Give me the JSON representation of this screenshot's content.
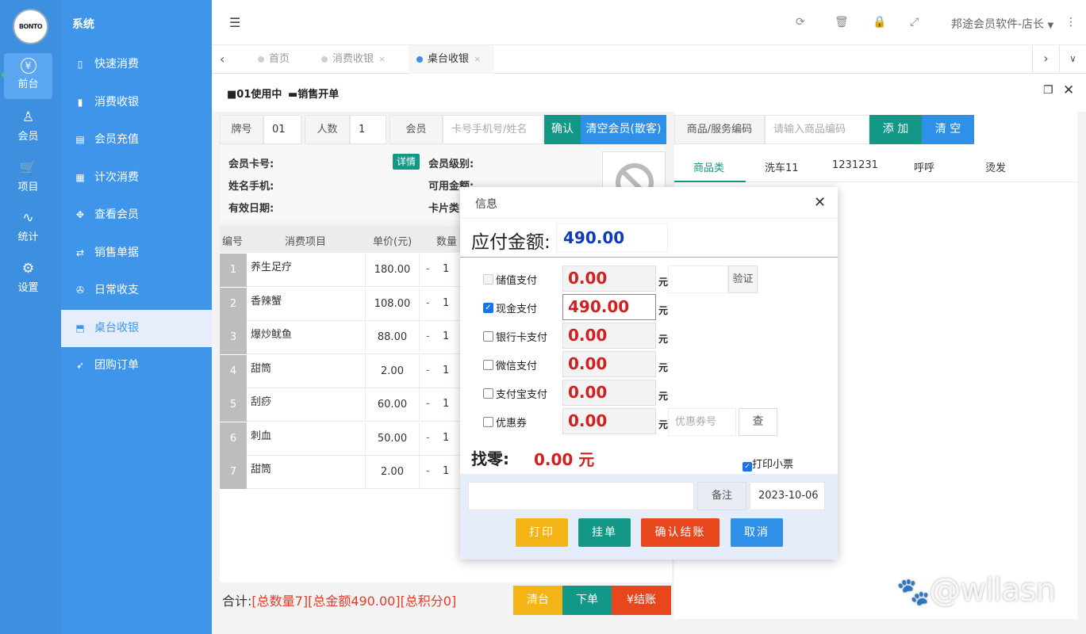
{
  "brand": {
    "logo_text": "BONTO"
  },
  "rail": {
    "items": [
      {
        "label": "前台",
        "icon": "yen-icon",
        "glyph": "¥"
      },
      {
        "label": "会员",
        "icon": "user-icon",
        "glyph": "♙"
      },
      {
        "label": "项目",
        "icon": "cart-icon",
        "glyph": "🛒"
      },
      {
        "label": "统计",
        "icon": "pulse-icon",
        "glyph": "∿"
      },
      {
        "label": "设置",
        "icon": "gear-icon",
        "glyph": "⚙"
      }
    ]
  },
  "menu": {
    "title": "系统",
    "items": [
      {
        "label": "快速消费",
        "icon": "bookmark-icon",
        "glyph": "▯"
      },
      {
        "label": "消费收银",
        "icon": "bookmark-fill-icon",
        "glyph": "▮"
      },
      {
        "label": "会员充值",
        "icon": "card-icon",
        "glyph": "▤"
      },
      {
        "label": "计次消费",
        "icon": "calculator-icon",
        "glyph": "▦"
      },
      {
        "label": "查看会员",
        "icon": "crosshair-icon",
        "glyph": "✥"
      },
      {
        "label": "销售单据",
        "icon": "swap-icon",
        "glyph": "⇄"
      },
      {
        "label": "日常收支",
        "icon": "dots-icon",
        "glyph": "✇"
      },
      {
        "label": "桌台收银",
        "icon": "inbox-icon",
        "glyph": "⬒"
      },
      {
        "label": "团购订单",
        "icon": "send-icon",
        "glyph": "➶"
      }
    ]
  },
  "topbar": {
    "user": "邦途会员软件-店长",
    "icons": [
      "menu-icon",
      "refresh-icon",
      "trash-icon",
      "lock-icon",
      "fullscreen-icon",
      "more-icon"
    ]
  },
  "tabs": [
    {
      "label": "首页"
    },
    {
      "label": "消费收银",
      "close": "×"
    },
    {
      "label": "桌台收银",
      "close": "×"
    }
  ],
  "work_header": {
    "table_status": "01使用中",
    "sale_open": "销售开单"
  },
  "order_form": {
    "table_label": "牌号",
    "table_value": "01",
    "people_label": "人数",
    "people_value": "1",
    "member_label": "会员",
    "member_placeholder": "卡号手机号/姓名",
    "confirm": "确认",
    "clear_member": "清空会员(散客)"
  },
  "product_form": {
    "code_label": "商品/服务编码",
    "code_placeholder": "请输入商品编码",
    "add": "添 加",
    "clear": "清 空"
  },
  "member_info": {
    "card_no": "会员卡号:",
    "detail": "详情",
    "level": "会员级别:",
    "phone": "姓名手机:",
    "balance": "可用金额:",
    "expiry": "有效日期:",
    "card_type": "卡片类"
  },
  "items_table": {
    "headers": [
      "编号",
      "消费项目",
      "单价(元)",
      "数量"
    ],
    "rows": [
      {
        "no": "1",
        "name": "养生足疗",
        "price": "180.00",
        "minus": "-",
        "qty": "1"
      },
      {
        "no": "2",
        "name": "香辣蟹",
        "price": "108.00",
        "minus": "-",
        "qty": "1"
      },
      {
        "no": "3",
        "name": "爆炒鱿鱼",
        "price": "88.00",
        "minus": "-",
        "qty": "1"
      },
      {
        "no": "4",
        "name": "甜筒",
        "price": "2.00",
        "minus": "-",
        "qty": "1"
      },
      {
        "no": "5",
        "name": "刮痧",
        "price": "60.00",
        "minus": "-",
        "qty": "1"
      },
      {
        "no": "6",
        "name": "刺血",
        "price": "50.00",
        "minus": "-",
        "qty": "1"
      },
      {
        "no": "7",
        "name": "甜筒",
        "price": "2.00",
        "minus": "-",
        "qty": "1"
      }
    ]
  },
  "footer": {
    "total_label": "合计:",
    "total_qty": "[总数量7]",
    "total_amount": "[总金额490.00]",
    "total_points": "[总积分0]",
    "clear_table": "清台",
    "place_order": "下单",
    "checkout": "¥结账"
  },
  "categories": [
    "商品类",
    "洗车11",
    "1231231",
    "呼呼",
    "烫发"
  ],
  "dialog": {
    "title": "信息",
    "payable_label": "应付金额:",
    "payable_value": "490.00",
    "payments": [
      {
        "label": "储值支付",
        "value": "0.00",
        "checked": false,
        "disabled": true
      },
      {
        "label": "现金支付",
        "value": "490.00",
        "checked": true
      },
      {
        "label": "银行卡支付",
        "value": "0.00",
        "checked": false
      },
      {
        "label": "微信支付",
        "value": "0.00",
        "checked": false
      },
      {
        "label": "支付宝支付",
        "value": "0.00",
        "checked": false
      },
      {
        "label": "优惠券",
        "value": "0.00",
        "checked": false
      }
    ],
    "unit": "元",
    "verify": "验证",
    "coupon_placeholder": "优惠券号",
    "query": "查",
    "change_label": "找零:",
    "change_value": "0.00 元",
    "print_receipt": "打印小票",
    "remark_label": "备注",
    "date": "2023-10-06",
    "btn_print": "打印",
    "btn_hold": "挂单",
    "btn_confirm": "确认结账",
    "btn_cancel": "取消"
  },
  "watermark": "@wllasn",
  "colors": {
    "rail": "#3d8fe0",
    "menu": "#3f95ea",
    "teal": "#139787",
    "blue_btn": "#2f90ea",
    "orange": "#e8471d",
    "yellow": "#f4b417",
    "red_text": "#d0201f"
  }
}
